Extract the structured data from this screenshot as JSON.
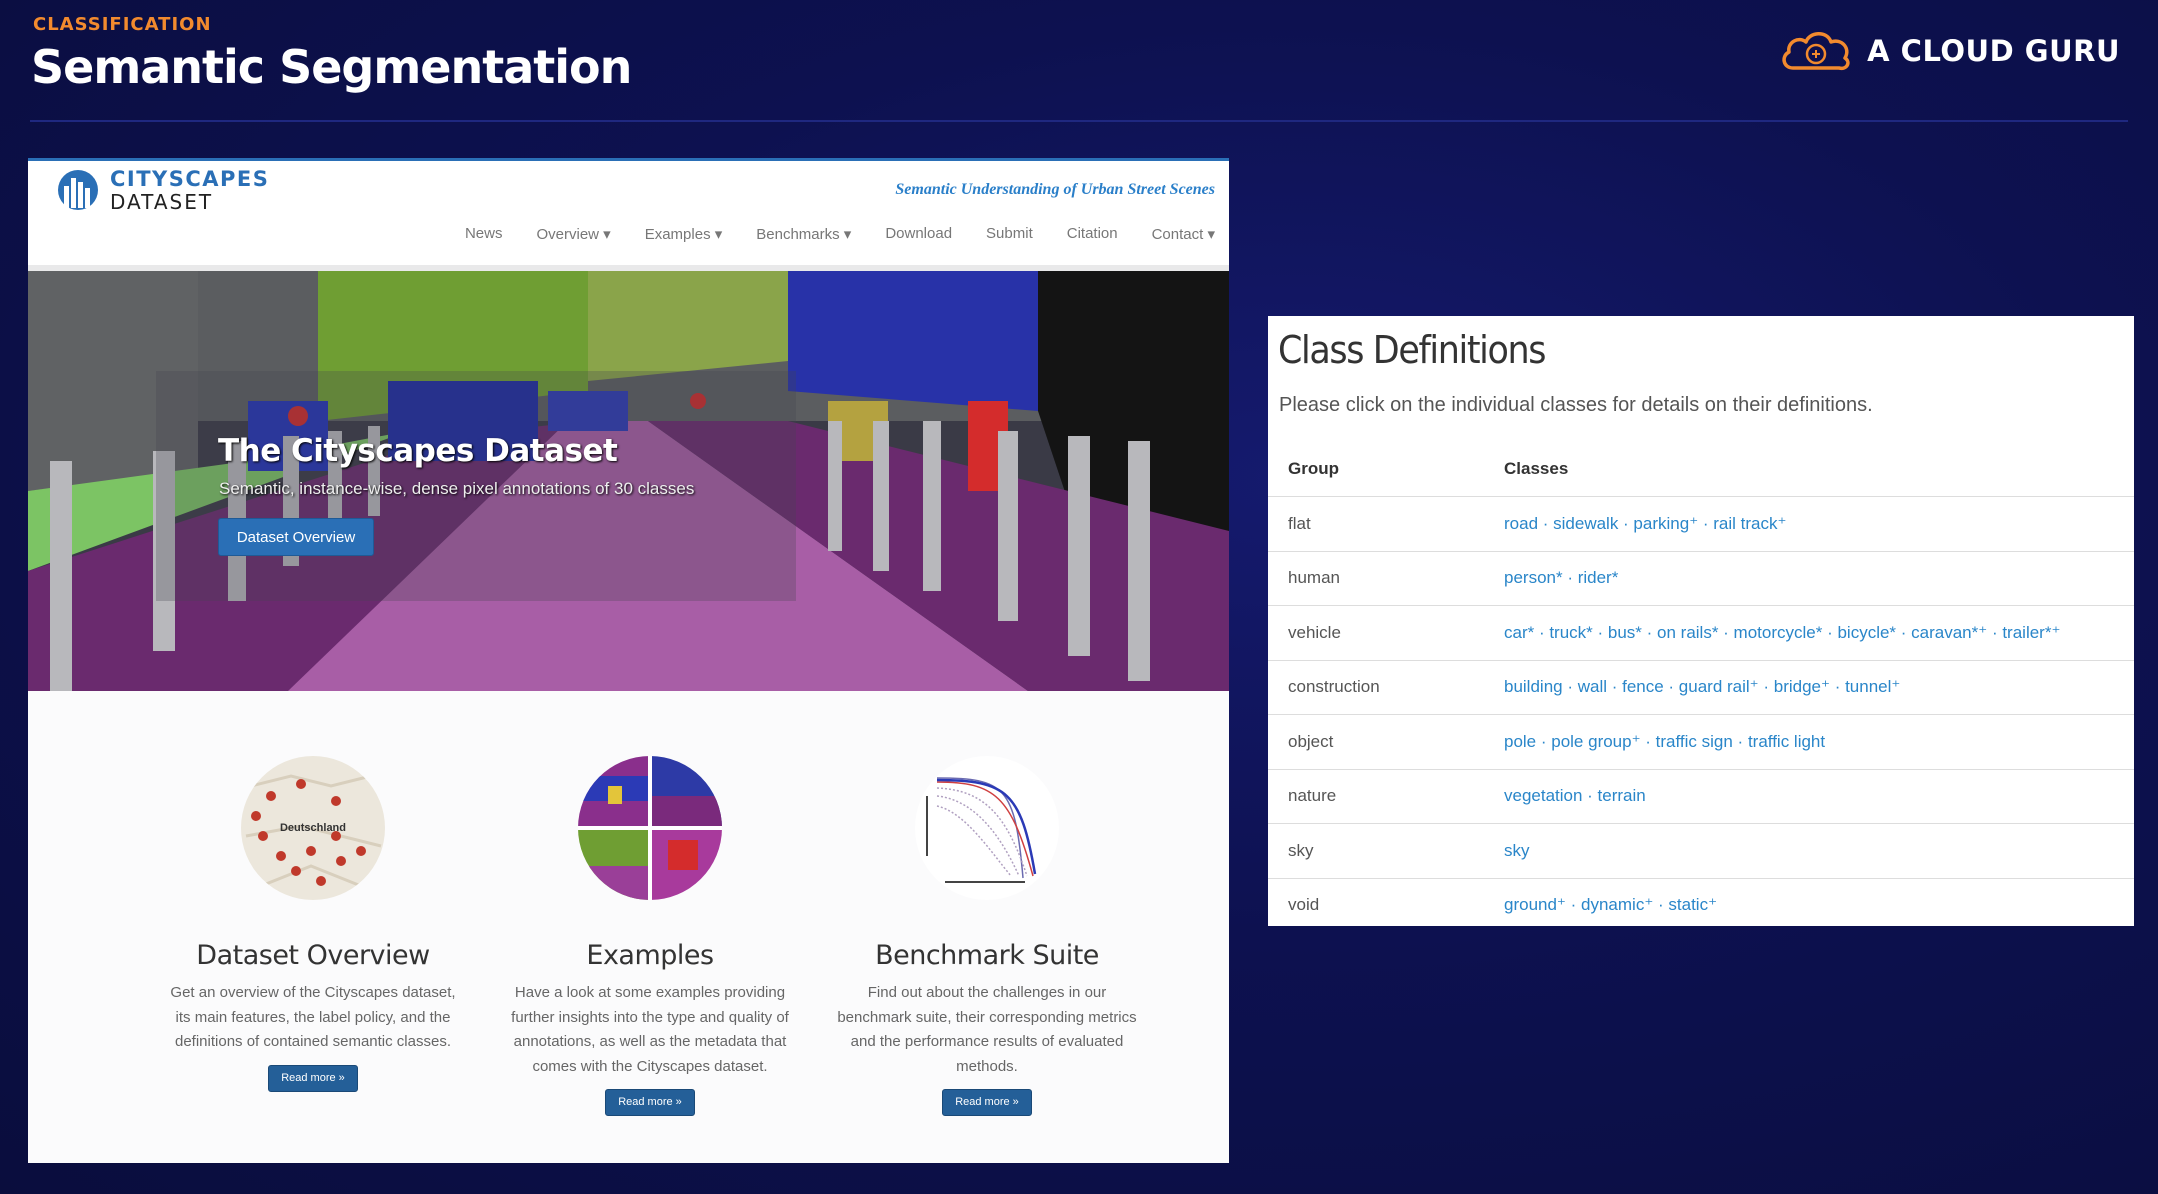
{
  "slide": {
    "kicker": "CLASSIFICATION",
    "title": "Semantic Segmentation",
    "brand": "A CLOUD GURU"
  },
  "site": {
    "logo_line1": "CITYSCAPES",
    "logo_line2": "DATASET",
    "tagline": "Semantic Understanding of Urban Street Scenes",
    "nav": [
      "News",
      "Overview ▾",
      "Examples ▾",
      "Benchmarks ▾",
      "Download",
      "Submit",
      "Citation",
      "Contact ▾"
    ],
    "hero": {
      "title": "The Cityscapes Dataset",
      "subtitle": "Semantic, instance-wise, dense pixel annotations of 30 classes",
      "button": "Dataset Overview"
    },
    "features": [
      {
        "title": "Dataset Overview",
        "desc": "Get an overview of the Cityscapes dataset, its main features, the label policy, and the definitions of contained semantic classes.",
        "button": "Read more »",
        "map_label": "Deutschland"
      },
      {
        "title": "Examples",
        "desc": "Have a look at some examples providing further insights into the type and quality of annotations, as well as the metadata that comes with the Cityscapes dataset.",
        "button": "Read more »"
      },
      {
        "title": "Benchmark Suite",
        "desc": "Find out about the challenges in our benchmark suite, their corresponding metrics and the performance results of evaluated methods.",
        "button": "Read more »"
      }
    ]
  },
  "class_definitions": {
    "title": "Class Definitions",
    "subtitle": "Please click on the individual classes for details on their definitions.",
    "headers": [
      "Group",
      "Classes"
    ],
    "rows": [
      {
        "group": "flat",
        "classes": "road · sidewalk · parking⁺ · rail track⁺"
      },
      {
        "group": "human",
        "classes": "person* · rider*"
      },
      {
        "group": "vehicle",
        "classes": "car* · truck* · bus* · on rails* · motorcycle* · bicycle* · caravan*⁺ · trailer*⁺"
      },
      {
        "group": "construction",
        "classes": "building · wall · fence · guard rail⁺ · bridge⁺ · tunnel⁺"
      },
      {
        "group": "object",
        "classes": "pole · pole group⁺ · traffic sign · traffic light"
      },
      {
        "group": "nature",
        "classes": "vegetation · terrain"
      },
      {
        "group": "sky",
        "classes": "sky"
      },
      {
        "group": "void",
        "classes": "ground⁺ · dynamic⁺ · static⁺"
      }
    ]
  },
  "colors": {
    "background": "#0d1150",
    "accent_orange": "#f28a2e",
    "link_blue": "#2a86c9",
    "button_blue": "#2a6fb6"
  }
}
